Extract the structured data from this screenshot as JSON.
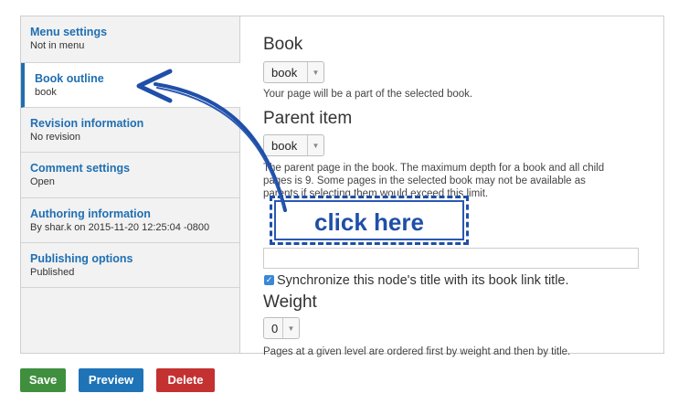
{
  "sidebar": {
    "items": [
      {
        "title": "Menu settings",
        "summary": "Not in menu"
      },
      {
        "title": "Book outline",
        "summary": "book"
      },
      {
        "title": "Revision information",
        "summary": "No revision"
      },
      {
        "title": "Comment settings",
        "summary": "Open"
      },
      {
        "title": "Authoring information",
        "summary": "By shar.k on 2015-11-20 12:25:04 -0800"
      },
      {
        "title": "Publishing options",
        "summary": "Published"
      }
    ]
  },
  "book": {
    "label": "Book",
    "selected": "book",
    "help": "Your page will be a part of the selected book."
  },
  "parent": {
    "label": "Parent item",
    "selected": "book",
    "help_line1": "The parent page in the book. The maximum depth for a book and all child",
    "help_line2": "pages is 9. Some pages in the selected book may not be available as",
    "help_line3": "parents if selecting them would exceed this limit."
  },
  "sync": {
    "label": "Synchronize this node's title with its book link title.",
    "checked": true
  },
  "weight": {
    "label": "Weight",
    "selected": "0",
    "help": "Pages at a given level are ordered first by weight and then by title."
  },
  "actions": {
    "save": "Save",
    "preview": "Preview",
    "delete": "Delete"
  },
  "annotation": {
    "text": "click here",
    "color": "#1f4fa8"
  },
  "colors": {
    "link": "#1f6fb2",
    "save": "#3f8f3f",
    "preview": "#1f73b7",
    "delete": "#c43131"
  }
}
